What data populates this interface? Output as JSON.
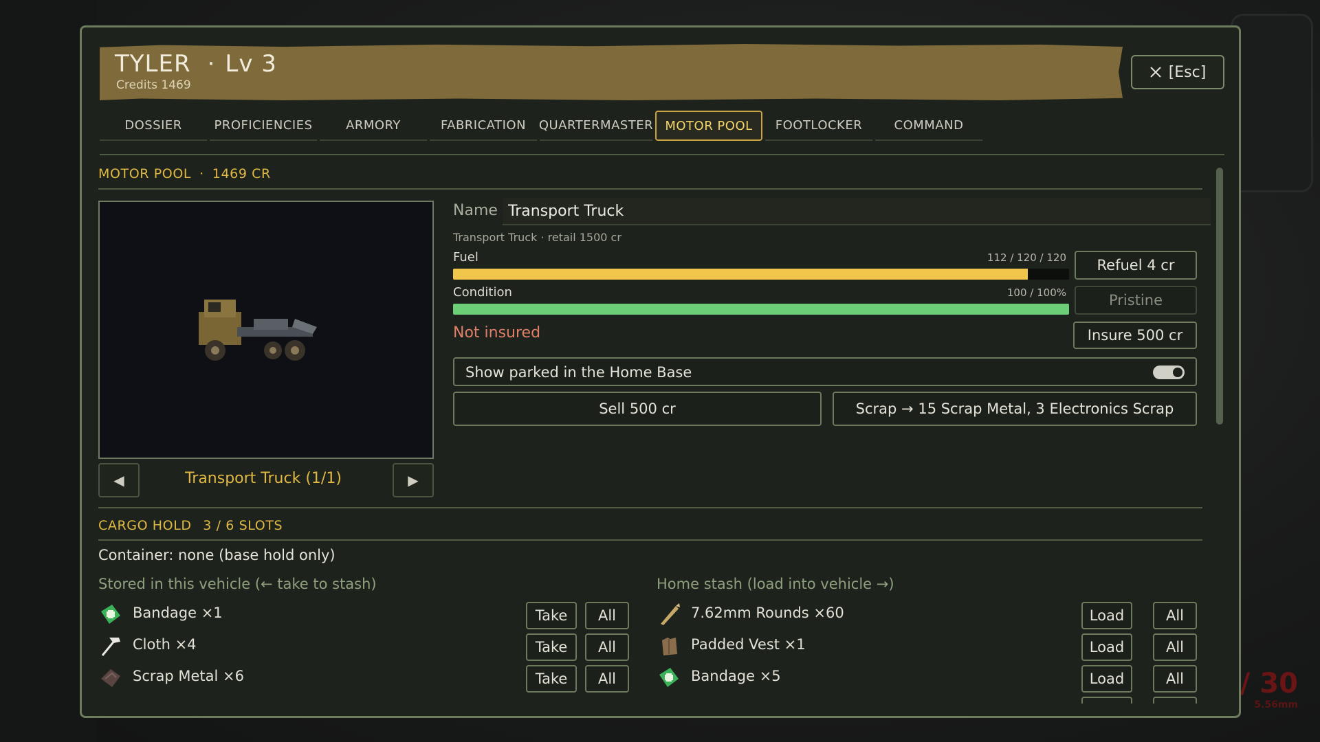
{
  "window": {
    "player_name": "TYLER",
    "separator": "·",
    "level": "Lv 3",
    "credits_label": "Credits",
    "credits_value": "1469",
    "close_label": "[Esc]"
  },
  "tabs": [
    {
      "label": "DOSSIER"
    },
    {
      "label": "PROFICIENCIES"
    },
    {
      "label": "ARMORY"
    },
    {
      "label": "FABRICATION"
    },
    {
      "label": "QUARTERMASTER"
    },
    {
      "label": "MOTOR POOL",
      "active": true
    },
    {
      "label": "FOOTLOCKER"
    },
    {
      "label": "COMMAND"
    }
  ],
  "motor_pool": {
    "title": "MOTOR POOL",
    "separator": "·",
    "credits": "1469 CR",
    "vehicle_label": "Transport Truck  (1/1)",
    "prev_icon": "◀",
    "next_icon": "▶",
    "name_label": "Name",
    "name_value": "Transport Truck",
    "subinfo": "Transport Truck  ·  retail 1500 cr",
    "fuel": {
      "label": "Fuel",
      "value_text": "112 / 120 / 120",
      "fraction": 0.933,
      "color": "#f0c64b"
    },
    "condition": {
      "label": "Condition",
      "value_text": "100 / 100%",
      "fraction": 1.0,
      "color": "#6ccf77"
    },
    "refuel_label": "Refuel 4 cr",
    "pristine_label": "Pristine",
    "insurance_status": "Not insured",
    "insure_label": "Insure 500 cr",
    "parked_label": "Show parked in the Home Base",
    "parked_on": true,
    "sell_label": "Sell  500 cr",
    "scrap_label": "Scrap  →  15 Scrap Metal, 3 Electronics Scrap"
  },
  "cargo": {
    "title": "CARGO HOLD",
    "slots": "3 / 6 SLOTS",
    "container": "Container: none (base hold only)",
    "stored_header": "Stored in this vehicle (← take to stash)",
    "stash_header": "Home stash (load into vehicle →)",
    "take_label": "Take",
    "load_label": "Load",
    "all_label": "All",
    "stored_items": [
      {
        "name": "Bandage ×1",
        "icon": "bandage-icon"
      },
      {
        "name": "Cloth ×4",
        "icon": "hammer-icon"
      },
      {
        "name": "Scrap Metal ×6",
        "icon": "scrap-metal-icon"
      }
    ],
    "stash_items": [
      {
        "name": "7.62mm Rounds ×60",
        "icon": "ammo-icon"
      },
      {
        "name": "Padded Vest ×1",
        "icon": "vest-icon"
      },
      {
        "name": "Bandage ×5",
        "icon": "bandage-icon"
      }
    ]
  },
  "hud": {
    "ammo": "/ 30",
    "caliber": "5.56mm"
  }
}
